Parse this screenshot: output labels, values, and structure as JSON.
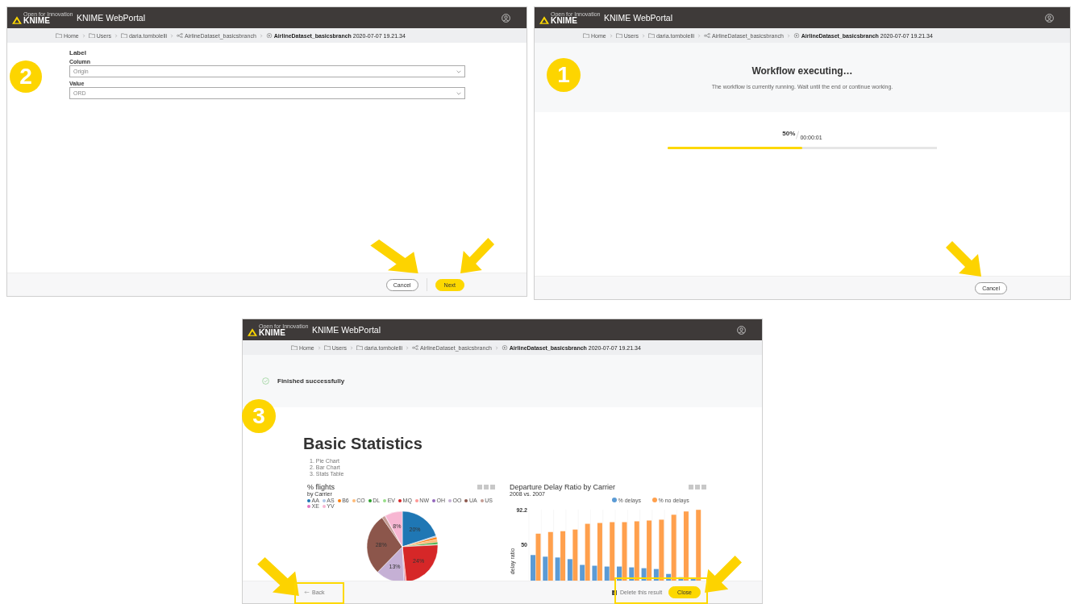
{
  "form_screen": {
    "step_badge": "2",
    "header": {
      "logo_tagline": "Open for Innovation",
      "logo_text": "KNIME",
      "title": "KNIME WebPortal"
    },
    "breadcrumb": [
      {
        "kind": "folder",
        "label": "Home"
      },
      {
        "kind": "folder",
        "label": "Users"
      },
      {
        "kind": "folder",
        "label": "daria.tombolelli"
      },
      {
        "kind": "workflow",
        "label": "AirlineDataset_basicsbranch"
      },
      {
        "kind": "job",
        "label": "**AirlineDataset_basicsbranch** 2020-07-07 19.21.34"
      }
    ],
    "section_title": "Label",
    "fields": [
      {
        "label": "Column",
        "value": "Origin"
      },
      {
        "label": "Value",
        "value": "ORD"
      }
    ],
    "buttons": [
      {
        "label": "Cancel",
        "kind": "secondary"
      },
      {
        "label": "Next",
        "kind": "primary"
      }
    ]
  },
  "executing_screen": {
    "step_badge": "1",
    "header": {
      "logo_tagline": "Open for Innovation",
      "logo_text": "KNIME",
      "title": "KNIME WebPortal"
    },
    "breadcrumb": [
      {
        "kind": "folder",
        "label": "Home"
      },
      {
        "kind": "folder",
        "label": "Users"
      },
      {
        "kind": "folder",
        "label": "daria.tombolelli"
      },
      {
        "kind": "workflow",
        "label": "AirlineDataset_basicsbranch"
      },
      {
        "kind": "job",
        "label": "**AirlineDataset_basicsbranch** 2020-07-07 19.21.34"
      }
    ],
    "title": "Workflow executing…",
    "message": "The workflow is currently running. Wait until the end or continue working.",
    "progress": {
      "percent": "50%",
      "elapsed": "00:00:01",
      "level": 0.5
    },
    "buttons": [
      {
        "label": "Cancel",
        "kind": "secondary"
      }
    ]
  },
  "result_screen": {
    "step_badge": "3",
    "header": {
      "logo_tagline": "Open for Innovation",
      "logo_text": "KNIME",
      "title": "KNIME WebPortal"
    },
    "breadcrumb": [
      {
        "kind": "folder",
        "label": "Home"
      },
      {
        "kind": "folder",
        "label": "Users"
      },
      {
        "kind": "folder",
        "label": "daria.tombolelli"
      },
      {
        "kind": "workflow",
        "label": "AirlineDataset_basicsbranch"
      },
      {
        "kind": "job",
        "label": "**AirlineDataset_basicsbranch** 2020-07-07 19.21.34"
      }
    ],
    "status": "Finished successfully",
    "report_title": "Basic Statistics",
    "contents": [
      "1. Pie Chart",
      "2. Bar Chart",
      "3. Stats Table"
    ],
    "pie_panel": {
      "subtitle": "by Carrier",
      "chart_data": {
        "type": "pie",
        "title": "% flights",
        "categories": [
          "AA",
          "AS",
          "B6",
          "CO",
          "DL",
          "EV",
          "MQ",
          "NW",
          "OH",
          "OO",
          "UA",
          "US",
          "XE",
          "YV"
        ],
        "colors": [
          "#1f77b4",
          "#aec7e8",
          "#ff7f0e",
          "#ffbb78",
          "#2ca02c",
          "#98df8a",
          "#d62728",
          "#ff9896",
          "#9467bd",
          "#c5b0d5",
          "#8c564b",
          "#c49c94",
          "#e377c2",
          "#f7b6d2"
        ],
        "values": [
          20,
          0.6,
          1,
          1.4,
          0.8,
          0.4,
          24,
          0.7,
          0.4,
          13,
          28,
          1.5,
          0.2,
          8
        ],
        "value_labels": [
          "20%",
          null,
          null,
          null,
          null,
          null,
          "24%",
          null,
          null,
          "13%",
          "28%",
          null,
          null,
          "8%"
        ]
      }
    },
    "bar_panel": {
      "subtitle": "2008 vs. 2007",
      "chart_data": {
        "type": "bar",
        "title": "Departure Delay Ratio by Carrier",
        "ylabel": "delay ratio",
        "legend": "top-right",
        "ylim": [
          0,
          92.2
        ],
        "yticks": [
          50,
          {
            "value": 92.2,
            "label": "92.2"
          }
        ],
        "series": [
          {
            "name": "% delays",
            "color": "#5b9bd5",
            "values": [
              37,
              35,
              34,
              32,
              25,
              24,
              23,
              23,
              22,
              21,
              20,
              14,
              10,
              8
            ]
          },
          {
            "name": "% no delays",
            "color": "#ffa04d",
            "values": [
              63,
              65,
              66,
              68,
              75,
              76,
              77,
              77,
              78,
              79,
              80,
              86,
              90,
              92
            ]
          }
        ]
      }
    },
    "back_link": "Back",
    "delete_result": {
      "label": "Delete this result",
      "checked": true
    },
    "buttons": [
      {
        "label": "Close",
        "kind": "primary"
      }
    ]
  }
}
